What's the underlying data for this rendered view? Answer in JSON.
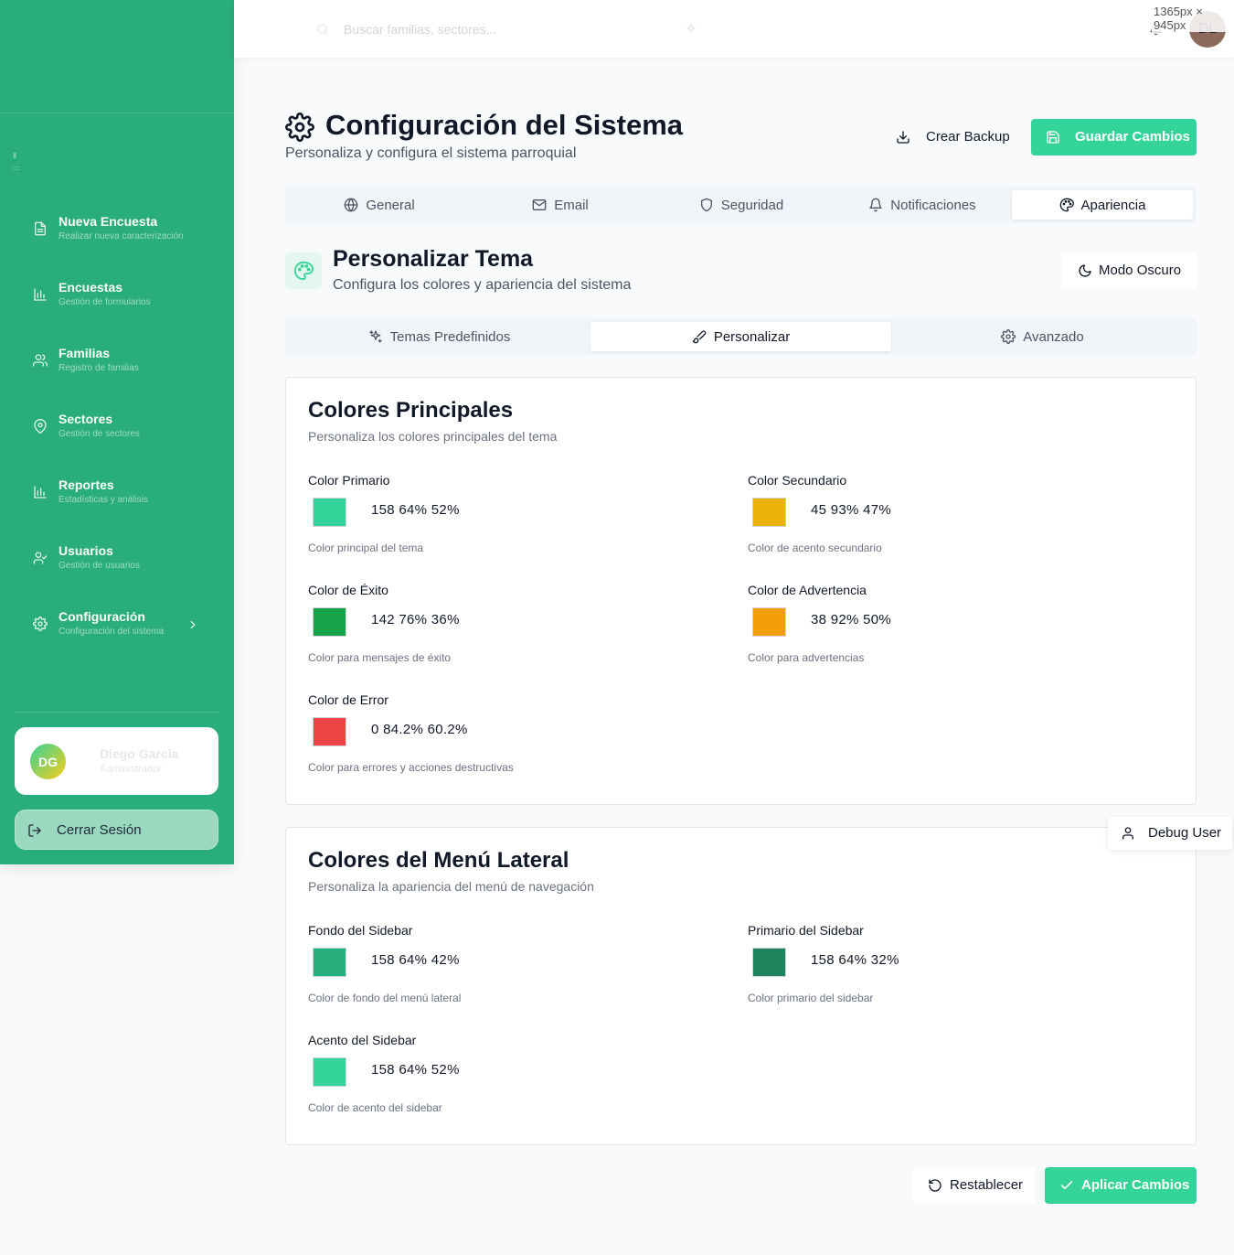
{
  "header": {
    "search_placeholder": "Buscar familias, sectores...",
    "avatar_initials": "DL",
    "size_badge": "1365px × 945px"
  },
  "sidebar": {
    "items": [
      {
        "label": "Nueva Encuesta",
        "sub": "Realizar nueva caracterización",
        "icon": "file-icon"
      },
      {
        "label": "Encuestas",
        "sub": "Gestión de formularios",
        "icon": "bar-chart-icon"
      },
      {
        "label": "Familias",
        "sub": "Registro de familias",
        "icon": "users-icon"
      },
      {
        "label": "Sectores",
        "sub": "Gestión de sectores",
        "icon": "map-pin-icon"
      },
      {
        "label": "Reportes",
        "sub": "Estadísticas y análisis",
        "icon": "bar-chart-icon"
      },
      {
        "label": "Usuarios",
        "sub": "Gestión de usuarios",
        "icon": "user-check-icon"
      },
      {
        "label": "Configuración",
        "sub": "Configuración del sistema",
        "icon": "gear-icon"
      }
    ],
    "user": {
      "initials": "DG",
      "name": "Diego Garcia",
      "role": "Administrador"
    },
    "logout_label": "Cerrar Sesión"
  },
  "page": {
    "title": "Configuración del Sistema",
    "subtitle": "Personaliza y configura el sistema parroquial",
    "backup_label": "Crear Backup",
    "save_label": "Guardar Cambios"
  },
  "tabs": [
    {
      "label": "General",
      "icon": "globe-icon",
      "active": false
    },
    {
      "label": "Email",
      "icon": "mail-icon",
      "active": false
    },
    {
      "label": "Seguridad",
      "icon": "shield-icon",
      "active": false
    },
    {
      "label": "Notificaciones",
      "icon": "bell-icon",
      "active": false
    },
    {
      "label": "Apariencia",
      "icon": "palette-icon",
      "active": true
    }
  ],
  "theme": {
    "title": "Personalizar Tema",
    "subtitle": "Configura los colores y apariencia del sistema",
    "dark_mode_label": "Modo Oscuro"
  },
  "subtabs": [
    {
      "label": "Temas Predefinidos",
      "icon": "sparkles-icon",
      "active": false
    },
    {
      "label": "Personalizar",
      "icon": "brush-icon",
      "active": true
    },
    {
      "label": "Avanzado",
      "icon": "gear-icon",
      "active": false
    }
  ],
  "main_colors": {
    "title": "Colores Principales",
    "subtitle": "Personaliza los colores principales del tema",
    "fields": [
      {
        "label": "Color Primario",
        "value": "158 64% 52%",
        "help": "Color principal del tema",
        "color": "#34d399"
      },
      {
        "label": "Color Secundario",
        "value": "45 93% 47%",
        "help": "Color de acento secundario",
        "color": "#eab308"
      },
      {
        "label": "Color de Éxito",
        "value": "142 76% 36%",
        "help": "Color para mensajes de éxito",
        "color": "#16a34a"
      },
      {
        "label": "Color de Advertencia",
        "value": "38 92% 50%",
        "help": "Color para advertencias",
        "color": "#f59e0b"
      },
      {
        "label": "Color de Error",
        "value": "0 84.2% 60.2%",
        "help": "Color para errores y acciones destructivas",
        "color": "#ef4444"
      }
    ]
  },
  "sidebar_colors": {
    "title": "Colores del Menú Lateral",
    "subtitle": "Personaliza la apariencia del menú de navegación",
    "fields": [
      {
        "label": "Fondo del Sidebar",
        "value": "158 64% 42%",
        "help": "Color de fondo del menú lateral",
        "color": "#27af7d"
      },
      {
        "label": "Primario del Sidebar",
        "value": "158 64% 32%",
        "help": "Color primario del sidebar",
        "color": "#1e855f"
      },
      {
        "label": "Acento del Sidebar",
        "value": "158 64% 52%",
        "help": "Color de acento del sidebar",
        "color": "#34d399"
      }
    ]
  },
  "debug_user_label": "Debug User",
  "actions": {
    "reset_label": "Restablecer",
    "apply_label": "Aplicar Cambios"
  },
  "colors": {
    "brand": "#34d399",
    "sidebar_bg": "#29ad7a"
  }
}
